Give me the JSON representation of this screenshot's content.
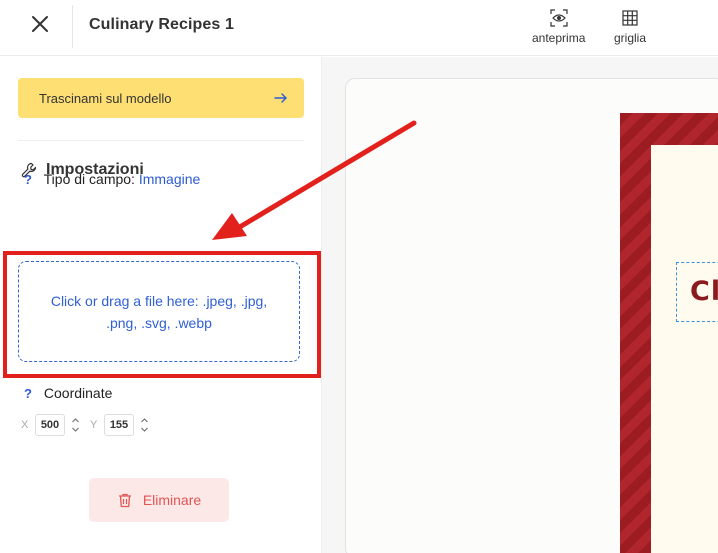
{
  "header": {
    "title": "Culinary Recipes 1",
    "tools": [
      {
        "label": "anteprima",
        "icon": "eye-icon"
      },
      {
        "label": "griglia",
        "icon": "grid-icon"
      }
    ]
  },
  "sidebar": {
    "drag_button": "Trascinami sul modello",
    "settings_title": "Impostazioni",
    "field_type_label": "Tipo di campo:",
    "field_type_value": "Immagine",
    "help_mark": "?",
    "dropzone_text": "Click or drag a file here: .jpeg, .jpg, .png, .svg, .webp",
    "coordinates_label": "Coordinate",
    "x_label": "X",
    "x_value": "500",
    "y_label": "Y",
    "y_value": "155",
    "delete_button": "Eliminare"
  },
  "canvas": {
    "title_text": "Cl"
  },
  "colors": {
    "accent_yellow": "#fddf73",
    "link_blue": "#2c5bd6",
    "danger": "#e05555",
    "annotation_red": "#e3211c",
    "template_red": "#9c1c22"
  }
}
